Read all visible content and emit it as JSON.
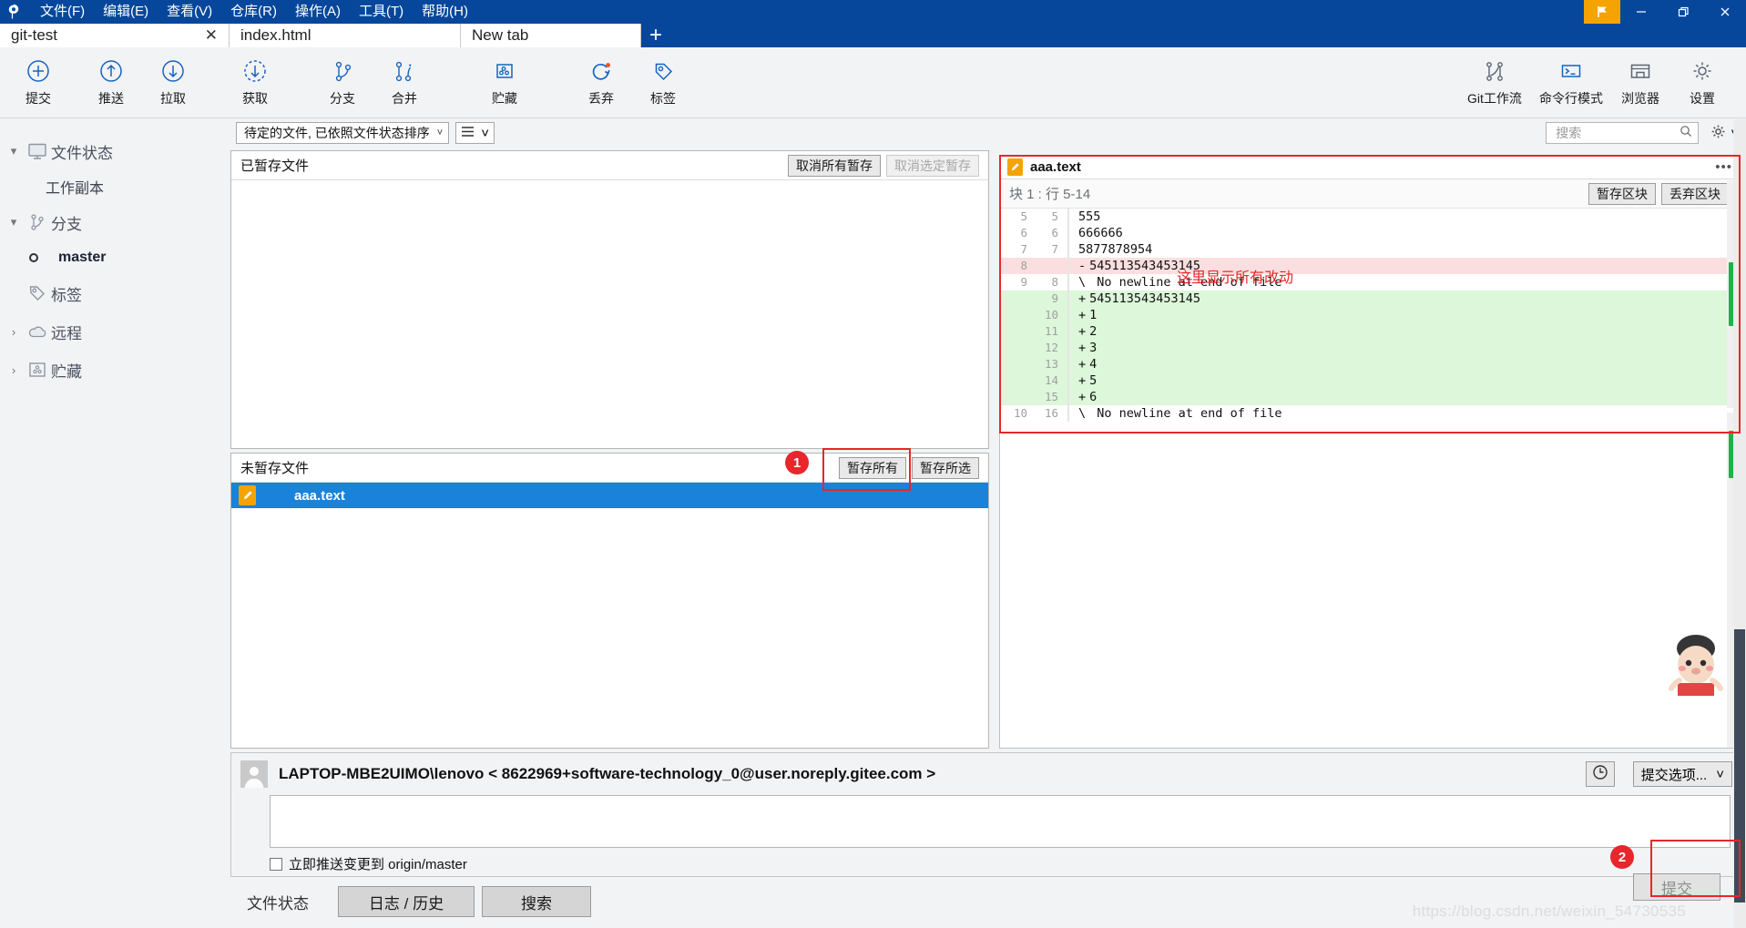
{
  "window": {
    "menus": [
      {
        "label": "文件(F)",
        "name": "menu-file"
      },
      {
        "label": "编辑(E)",
        "name": "menu-edit"
      },
      {
        "label": "查看(V)",
        "name": "menu-view"
      },
      {
        "label": "仓库(R)",
        "name": "menu-repository"
      },
      {
        "label": "操作(A)",
        "name": "menu-actions"
      },
      {
        "label": "工具(T)",
        "name": "menu-tools"
      },
      {
        "label": "帮助(H)",
        "name": "menu-help"
      }
    ],
    "controls": {
      "minimize": "—",
      "maximize": "❐",
      "close": "✕"
    },
    "accent": "#06479c",
    "flag_color": "#f5a300"
  },
  "tabs": [
    {
      "label": "git-test",
      "active": true,
      "closable": true
    },
    {
      "label": "index.html",
      "active": false,
      "closable": false
    },
    {
      "label": "New tab",
      "active": false,
      "closable": false
    }
  ],
  "tab_add_label": "+",
  "toolbar": {
    "items": [
      {
        "label": "提交",
        "icon": "plus-circle-icon"
      },
      {
        "label": "推送",
        "icon": "arrow-up-circle-icon"
      },
      {
        "label": "拉取",
        "icon": "arrow-down-circle-icon"
      },
      {
        "label": "获取",
        "icon": "arrow-down-dashed-circle-icon"
      },
      {
        "label": "分支",
        "icon": "branch-icon"
      },
      {
        "label": "合并",
        "icon": "merge-icon"
      },
      {
        "label": "贮藏",
        "icon": "stash-box-icon"
      },
      {
        "label": "丢弃",
        "icon": "discard-refresh-icon"
      },
      {
        "label": "标签",
        "icon": "tag-icon"
      }
    ],
    "right_items": [
      {
        "label": "Git工作流",
        "icon": "gitflow-icon"
      },
      {
        "label": "命令行模式",
        "icon": "terminal-icon"
      },
      {
        "label": "浏览器",
        "icon": "explorer-icon"
      },
      {
        "label": "设置",
        "icon": "gear-icon"
      }
    ]
  },
  "sidebar": {
    "items": [
      {
        "label": "文件状态",
        "icon": "monitor-icon",
        "twisty": "▾",
        "level": 0
      },
      {
        "label": "工作副本",
        "icon": "",
        "twisty": "",
        "level": 1
      },
      {
        "label": "分支",
        "icon": "branch-icon",
        "twisty": "▾",
        "level": 0
      },
      {
        "label": "master",
        "icon": "circle-icon",
        "twisty": "",
        "level": 1
      },
      {
        "label": "标签",
        "icon": "tag-icon",
        "twisty": "",
        "level": 0
      },
      {
        "label": "远程",
        "icon": "cloud-icon",
        "twisty": "›",
        "level": 0
      },
      {
        "label": "贮藏",
        "icon": "stash-box-icon",
        "twisty": "›",
        "level": 0
      }
    ]
  },
  "panel_toolbar": {
    "sort_combo_value": "待定的文件, 已依照文件状态排序",
    "view_combo_icon": "list-view-icon",
    "search_placeholder": "搜索",
    "search_value": "",
    "search_icon": "search-icon",
    "gear_icon": "gear-icon"
  },
  "staged": {
    "title": "已暂存文件",
    "unstage_all_label": "取消所有暂存",
    "unstage_selected_label": "取消选定暂存",
    "files": []
  },
  "unstaged": {
    "title": "未暂存文件",
    "stage_all_label": "暂存所有",
    "stage_selected_label": "暂存所选",
    "files": [
      {
        "name": "aaa.text",
        "status_icon": "modified-pencil-icon",
        "selected": true
      }
    ]
  },
  "diff": {
    "filename": "aaa.text",
    "file_icon": "modified-pencil-icon",
    "more_icon": "ellipsis-icon",
    "hunk_label": "块 1 : 行 5-14",
    "stage_hunk_label": "暂存区块",
    "discard_hunk_label": "丢弃区块",
    "annotation": "这里显示所有改动",
    "lines": [
      {
        "old": "5",
        "new": "5",
        "marker": " ",
        "text": "555",
        "type": "ctx"
      },
      {
        "old": "6",
        "new": "6",
        "marker": " ",
        "text": "666666",
        "type": "ctx"
      },
      {
        "old": "7",
        "new": "7",
        "marker": " ",
        "text": "5877878954",
        "type": "ctx"
      },
      {
        "old": "8",
        "new": "",
        "marker": "-",
        "text": "545113543453145",
        "type": "del"
      },
      {
        "old": "9",
        "new": "8",
        "marker": "\\",
        "text": " No newline at end of file",
        "type": "meta"
      },
      {
        "old": "",
        "new": "9",
        "marker": "+",
        "text": "545113543453145",
        "type": "add"
      },
      {
        "old": "",
        "new": "10",
        "marker": "+",
        "text": "1",
        "type": "add"
      },
      {
        "old": "",
        "new": "11",
        "marker": "+",
        "text": "2",
        "type": "add"
      },
      {
        "old": "",
        "new": "12",
        "marker": "+",
        "text": "3",
        "type": "add"
      },
      {
        "old": "",
        "new": "13",
        "marker": "+",
        "text": "4",
        "type": "add"
      },
      {
        "old": "",
        "new": "14",
        "marker": "+",
        "text": "5",
        "type": "add"
      },
      {
        "old": "",
        "new": "15",
        "marker": "+",
        "text": "6",
        "type": "add"
      },
      {
        "old": "10",
        "new": "16",
        "marker": "\\",
        "text": " No newline at end of file",
        "type": "meta"
      }
    ]
  },
  "commit": {
    "author": "LAPTOP-MBE2UIMO\\lenovo < 8622969+software-technology_0@user.noreply.gitee.com >",
    "avatar_icon": "avatar-icon",
    "history_icon": "clock-icon",
    "commit_options_label": "提交选项...",
    "message_value": "",
    "push_checkbox_label": "立即推送变更到 origin/master",
    "push_checked": false,
    "commit_button_label": "提交"
  },
  "bottom_tabs": [
    {
      "label": "文件状态",
      "active": true
    },
    {
      "label": "日志 / 历史",
      "active": false
    },
    {
      "label": "搜索",
      "active": false
    }
  ],
  "annotations": {
    "badge1": "1",
    "badge2": "2",
    "accent_red": "#e8262b"
  },
  "watermark": "https://blog.csdn.net/weixin_54730535"
}
